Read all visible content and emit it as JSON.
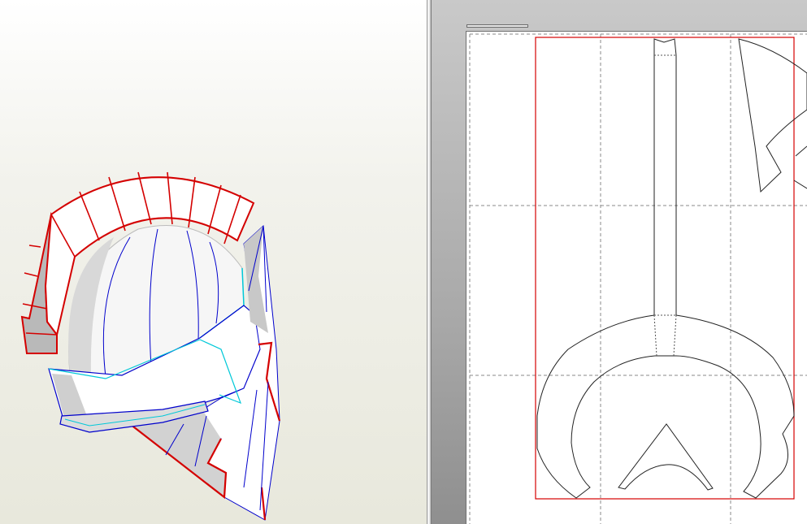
{
  "app": {
    "left_pane": "3d-model-view",
    "right_pane": "2d-unfold-view"
  },
  "colors": {
    "cut_line": "#d40000",
    "fold_line": "#0000cc",
    "seam_line": "#00c8d8",
    "page_border": "#d40000",
    "grid_line": "#888888",
    "outline": "#222222"
  },
  "icons": {
    "helmet_model": "helmet-model-icon"
  }
}
